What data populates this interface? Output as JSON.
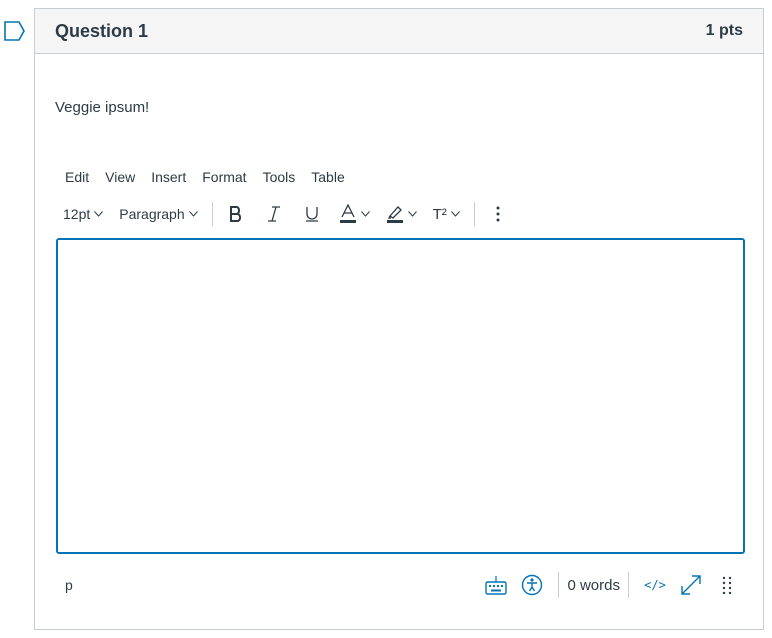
{
  "question": {
    "title": "Question 1",
    "points": "1 pts",
    "text": "Veggie ipsum!"
  },
  "editor": {
    "menus": [
      "Edit",
      "View",
      "Insert",
      "Format",
      "Tools",
      "Table"
    ],
    "font_size": "12pt",
    "block_format": "Paragraph",
    "superscript_label": "T²",
    "content": ""
  },
  "statusbar": {
    "path": "p",
    "word_count": "0 words",
    "html_toggle": "</>"
  },
  "colors": {
    "accent": "#0374b5",
    "text": "#2d3b45",
    "border": "#c7cdd1",
    "header_bg": "#f5f5f5"
  },
  "icons": [
    "flag-icon",
    "bold-icon",
    "italic-icon",
    "underline-icon",
    "text-color-icon",
    "highlight-icon",
    "superscript-icon",
    "more-icon",
    "keyboard-icon",
    "accessibility-icon",
    "fullscreen-icon",
    "resize-handle-icon"
  ]
}
